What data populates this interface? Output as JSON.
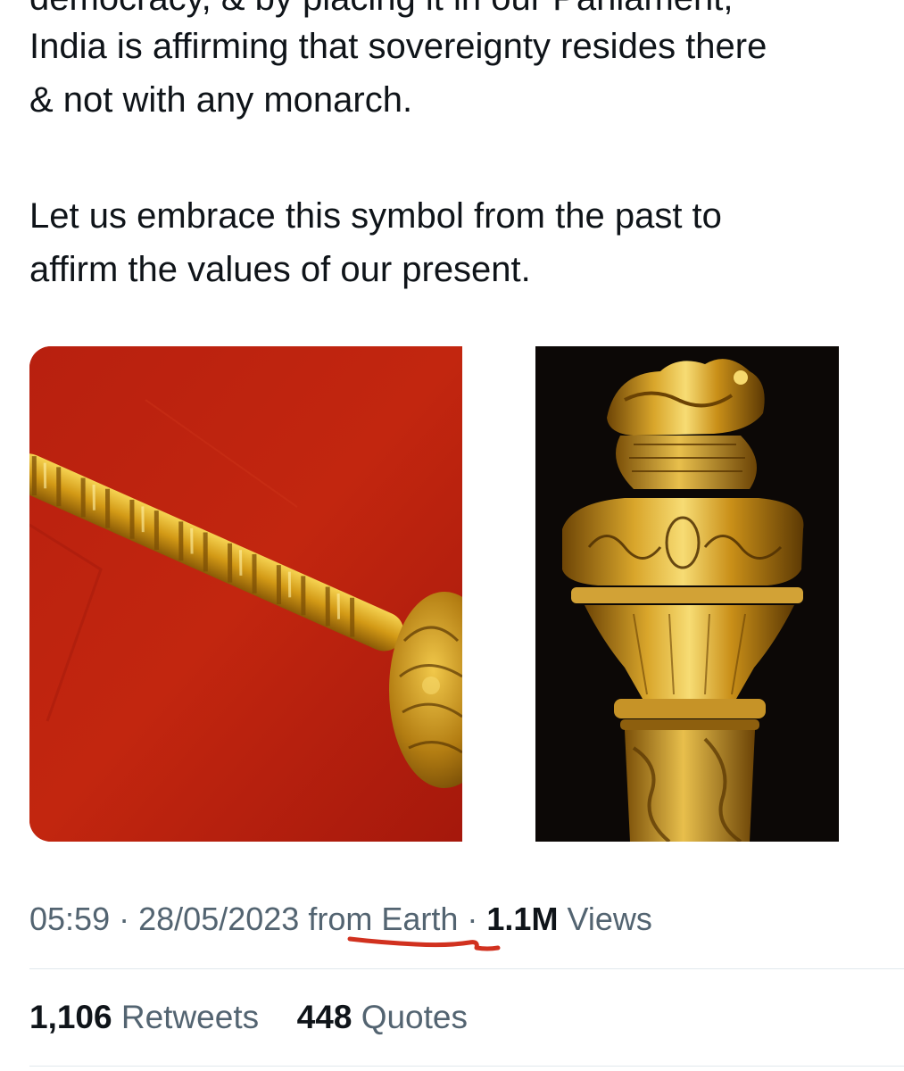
{
  "tweet": {
    "cut_line": "democracy, & by placing it in our Parliament,",
    "paragraph_1_line_1": "India is affirming that sovereignty resides there",
    "paragraph_1_line_2": "& not with any monarch.",
    "paragraph_2_line_1": "Let us embrace this symbol from the past to",
    "paragraph_2_line_2": "affirm the values of our present."
  },
  "media": {
    "images": [
      {
        "name": "golden sceptre shaft on red cloth",
        "background": "#b51d10"
      },
      {
        "name": "golden sceptre head with nandi on black background",
        "background": "#0c0806"
      }
    ]
  },
  "meta": {
    "time": "05:59",
    "separator": "·",
    "date": "28/05/2023",
    "source": "from Earth",
    "views_count": "1.1M",
    "views_label": "Views",
    "underline_color": "#d1311f"
  },
  "stats": {
    "retweets_count": "1,106",
    "retweets_label": "Retweets",
    "quotes_count": "448",
    "quotes_label": "Quotes"
  },
  "colors": {
    "text_primary": "#0f1419",
    "text_secondary": "#536471",
    "divider": "#e1e8ed"
  }
}
